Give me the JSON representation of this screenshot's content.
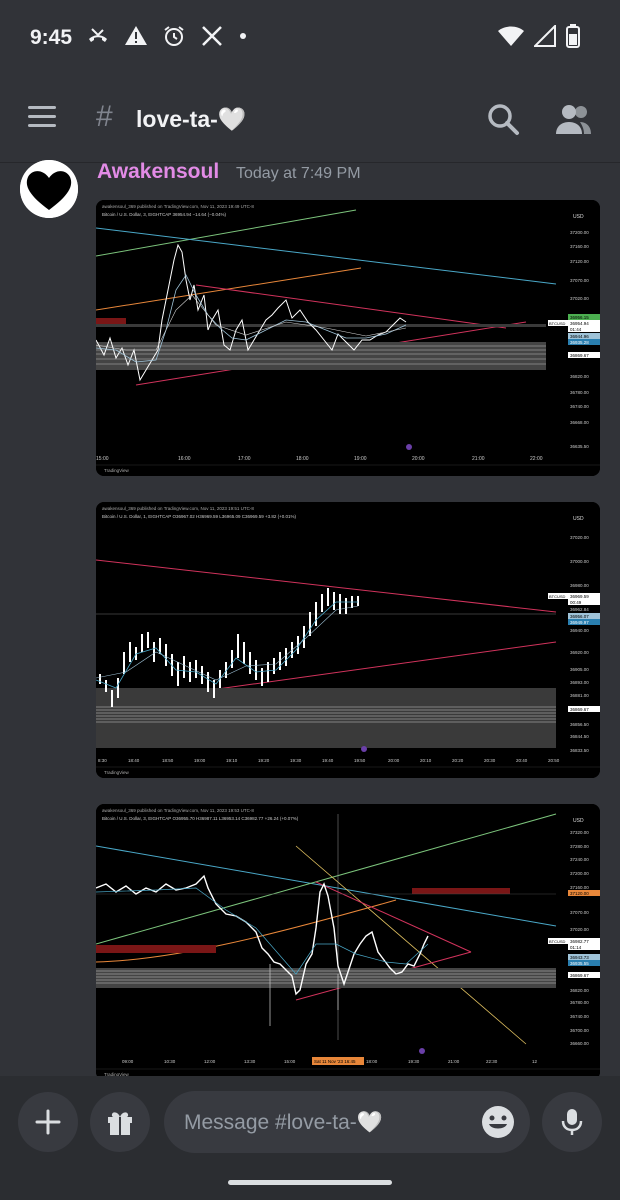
{
  "status_bar": {
    "time": "9:45",
    "left_icons": [
      "missed-call-icon",
      "warning-icon",
      "alarm-icon",
      "x-logo-icon",
      "dot-icon"
    ],
    "right_icons": [
      "wifi-icon",
      "signal-icon",
      "battery-icon"
    ]
  },
  "header": {
    "channel_name": "love-ta-🤍",
    "hash": "#"
  },
  "message": {
    "username": "Awakensoul",
    "timestamp": "Today at 7:49 PM",
    "username_color": "#e28be6"
  },
  "charts": [
    {
      "publisher": "awakensoul_369 published on TradingView.com, Nov 11, 2023 19:49 UTC-8",
      "symbol_line": "Bitcoin / U.S. Dollar, 3, EIGHTCAP  36954.94  −14.64 (−0.04%)",
      "currency": "USD",
      "symbol_tag": "BTCUSD",
      "price_labels": [
        "37200.00",
        "37160.00",
        "37120.00",
        "37070.00",
        "37020.00",
        "36956.15",
        "36954.94",
        "01:44",
        "36944.96",
        "36935.28",
        "36869.67",
        "36820.00",
        "36780.00",
        "36740.00",
        "36668.00",
        "36635.50"
      ],
      "time_labels": [
        "15:00",
        "16:00",
        "17:00",
        "18:00",
        "19:00",
        "20:00",
        "21:00",
        "22:00"
      ],
      "footer": "TradingView"
    },
    {
      "publisher": "awakensoul_369 published on TradingView.com, Nov 11, 2023 19:51 UTC-8",
      "symbol_line": "Bitcoin / U.S. Dollar, 1, EIGHTCAP  O36967.02  H36969.59  L36965.09  C36969.59  +3.82 (+0.01%)",
      "currency": "USD",
      "symbol_tag": "BTCUSD",
      "price_labels": [
        "37020.00",
        "37000.00",
        "36980.00",
        "36969.59",
        "00:49",
        "36962.84",
        "36956.07",
        "36949.97",
        "36940.00",
        "36920.00",
        "36905.00",
        "36893.00",
        "36881.00",
        "36869.67",
        "36856.50",
        "36844.50",
        "36833.50"
      ],
      "time_labels": [
        "8:30",
        "18:40",
        "18:50",
        "19:00",
        "19:10",
        "19:20",
        "19:30",
        "19:40",
        "19:50",
        "20:00",
        "20:10",
        "20:20",
        "20:30",
        "20:40",
        "20:50"
      ],
      "footer": "TradingView"
    },
    {
      "publisher": "awakensoul_369 published on TradingView.com, Nov 11, 2023 19:53 UTC-8",
      "symbol_line": "Bitcoin / U.S. Dollar, 3, EIGHTCAP  O36955.70  H36987.11  L36953.14  C36982.77  +26.24 (+0.07%)",
      "currency": "USD",
      "symbol_tag": "BTCUSD",
      "price_labels": [
        "37320.00",
        "37280.00",
        "37240.00",
        "37200.00",
        "37160.00",
        "37120.00",
        "37070.00",
        "37020.00",
        "36982.77",
        "01:14",
        "36943.73",
        "36935.55",
        "36869.67",
        "36820.00",
        "36780.00",
        "36740.00",
        "36700.00",
        "36660.00"
      ],
      "time_labels": [
        "09:00",
        "10:30",
        "12:00",
        "13:30",
        "15:00",
        "16:30",
        "18:00",
        "19:30",
        "21:00",
        "22:30",
        "12"
      ],
      "date_tag": "Sat 11 Nov '23  16:45",
      "footer": "TradingView"
    }
  ],
  "composer": {
    "placeholder": "Message #love-ta-🤍",
    "buttons": [
      "plus-icon",
      "gift-icon",
      "mic-icon"
    ]
  }
}
